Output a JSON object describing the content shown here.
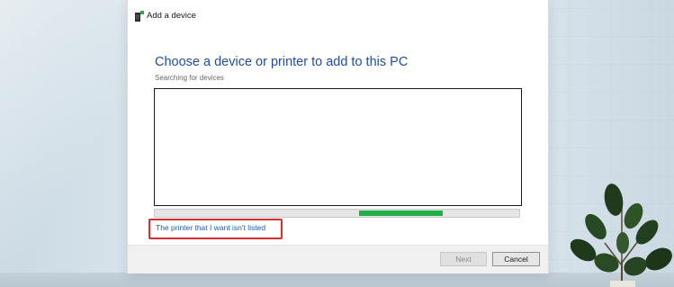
{
  "window": {
    "title": "Add a device",
    "icon": "device-add-icon"
  },
  "main": {
    "heading": "Choose a device or printer to add to this PC",
    "status": "Searching for devices",
    "device_list": [],
    "progress": {
      "indeterminate": true,
      "segment_start_fraction": 0.56,
      "segment_end_fraction": 0.79,
      "color": "#1fb04a"
    },
    "link_text": "The printer that I want isn't listed",
    "link_highlight_color": "#d42f2f"
  },
  "footer": {
    "next_label": "Next",
    "next_enabled": false,
    "cancel_label": "Cancel"
  },
  "colors": {
    "heading": "#1f4e9c",
    "link": "#1a5fb4"
  }
}
